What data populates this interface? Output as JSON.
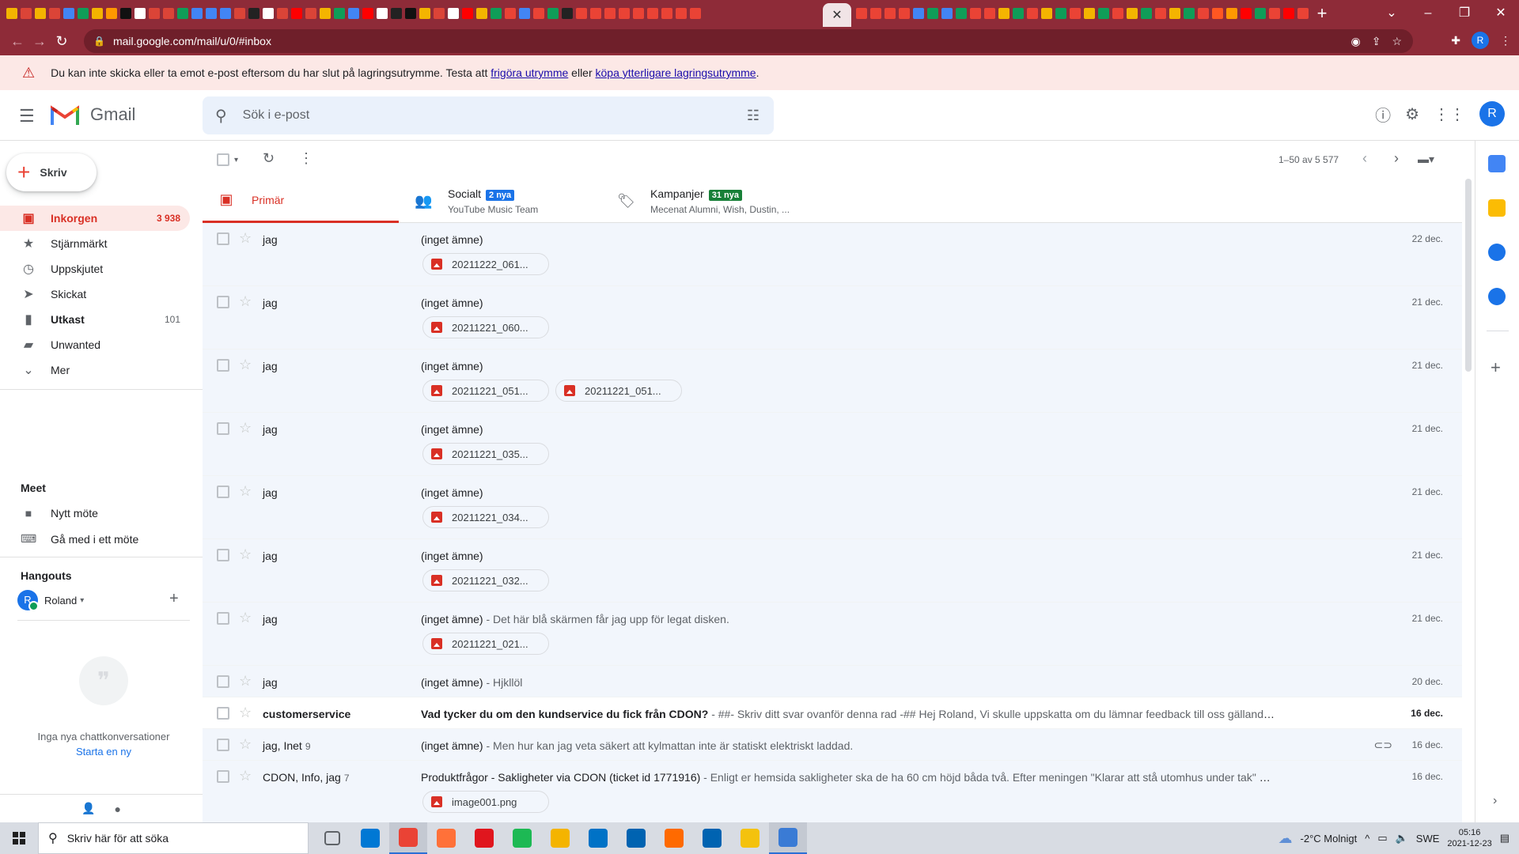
{
  "browser": {
    "url": "mail.google.com/mail/u/0/#inbox",
    "profile_initial": "R",
    "favicon_colors": [
      "#f4b400",
      "#db4437",
      "#f4b400",
      "#db4437",
      "#4285f4",
      "#0f9d58",
      "#f4b400",
      "#ff9800",
      "#111111",
      "#ffffff",
      "#db4437",
      "#db4437",
      "#0f9d58",
      "#4285f4",
      "#4285f4",
      "#4285f4",
      "#db4437",
      "#222222",
      "#ffffff",
      "#db4437",
      "#ff0000",
      "#db4437",
      "#f4b400",
      "#0f9d58",
      "#4285f4",
      "#ff0000",
      "#ffffff",
      "#222222",
      "#111111",
      "#f4b400",
      "#db4437",
      "#ffffff",
      "#ff0000",
      "#f4b400",
      "#0f9d58",
      "#ea4335",
      "#4285f4",
      "#ea4335",
      "#0f9d58",
      "#222222",
      "#ea4335",
      "#ea4335",
      "#ea4335",
      "#ea4335",
      "#ea4335",
      "#ea4335",
      "#ea4335",
      "#ea4335",
      "#ea4335"
    ],
    "favicon_colors_2": [
      "#ea4335",
      "#ea4335",
      "#ea4335",
      "#ea4335",
      "#4285f4",
      "#0f9d58",
      "#4285f4",
      "#0f9d58",
      "#ea4335",
      "#ea4335",
      "#f4b400",
      "#0f9d58",
      "#ea4335",
      "#f4b400",
      "#0f9d58",
      "#ea4335",
      "#f4b400",
      "#0f9d58",
      "#ea4335",
      "#f4b400",
      "#0f9d58",
      "#ea4335",
      "#f4b400",
      "#0f9d58",
      "#ea4335",
      "#ff5722",
      "#ff9800",
      "#ff0000",
      "#0f9d58",
      "#ea4335",
      "#ff0000",
      "#ea4335",
      "#ea4335"
    ],
    "tab_close": "✕",
    "new_tab": "+"
  },
  "banner": {
    "text_before": "Du kan inte skicka eller ta emot e-post eftersom du har slut på lagringsutrymme. Testa att ",
    "link1": "frigöra utrymme",
    "text_middle": " eller ",
    "link2": "köpa ytterligare lagringsutrymme",
    "text_after": "."
  },
  "header": {
    "app_name": "Gmail",
    "search_placeholder": "Sök i e-post",
    "avatar_initial": "R"
  },
  "compose": {
    "label": "Skriv"
  },
  "nav": [
    {
      "label": "Inkorgen",
      "count": "3 938",
      "icon": "inbox-icon"
    },
    {
      "label": "Stjärnmärkt",
      "count": "",
      "icon": "star-icon"
    },
    {
      "label": "Uppskjutet",
      "count": "",
      "icon": "clock-icon"
    },
    {
      "label": "Skickat",
      "count": "",
      "icon": "send-icon"
    },
    {
      "label": "Utkast",
      "count": "101",
      "icon": "draft-icon"
    },
    {
      "label": "Unwanted",
      "count": "",
      "icon": "label-icon"
    },
    {
      "label": "Mer",
      "count": "",
      "icon": "chevron-down-icon"
    }
  ],
  "meet": {
    "title": "Meet",
    "new_meeting": "Nytt möte",
    "join_meeting": "Gå med i ett möte"
  },
  "hangouts": {
    "title": "Hangouts",
    "user": "Roland",
    "user_initial": "R",
    "empty_text": "Inga nya chattkonversationer",
    "start_link": "Starta en ny"
  },
  "list": {
    "range": "1–50 av 5 577"
  },
  "tabs": [
    {
      "name": "Primär",
      "badge": "",
      "sub": ""
    },
    {
      "name": "Socialt",
      "badge": "2 nya",
      "sub": "YouTube Music Team"
    },
    {
      "name": "Kampanjer",
      "badge": "31 nya",
      "sub": "Mecenat Alumni, Wish, Dustin, ..."
    }
  ],
  "emails": [
    {
      "sender": "jag",
      "count": "",
      "subject": "(inget ämne)",
      "snippet": "",
      "date": "22 dec.",
      "attachments": [
        "20211222_061..."
      ],
      "unread": false,
      "clip": false
    },
    {
      "sender": "jag",
      "count": "",
      "subject": "(inget ämne)",
      "snippet": "",
      "date": "21 dec.",
      "attachments": [
        "20211221_060..."
      ],
      "unread": false,
      "clip": false
    },
    {
      "sender": "jag",
      "count": "",
      "subject": "(inget ämne)",
      "snippet": "",
      "date": "21 dec.",
      "attachments": [
        "20211221_051...",
        "20211221_051..."
      ],
      "unread": false,
      "clip": false
    },
    {
      "sender": "jag",
      "count": "",
      "subject": "(inget ämne)",
      "snippet": "",
      "date": "21 dec.",
      "attachments": [
        "20211221_035..."
      ],
      "unread": false,
      "clip": false
    },
    {
      "sender": "jag",
      "count": "",
      "subject": "(inget ämne)",
      "snippet": "",
      "date": "21 dec.",
      "attachments": [
        "20211221_034..."
      ],
      "unread": false,
      "clip": false
    },
    {
      "sender": "jag",
      "count": "",
      "subject": "(inget ämne)",
      "snippet": "",
      "date": "21 dec.",
      "attachments": [
        "20211221_032..."
      ],
      "unread": false,
      "clip": false
    },
    {
      "sender": "jag",
      "count": "",
      "subject": "(inget ämne)",
      "snippet": " - Det här blå skärmen får jag upp för legat disken.",
      "date": "21 dec.",
      "attachments": [
        "20211221_021..."
      ],
      "unread": false,
      "clip": false
    },
    {
      "sender": "jag",
      "count": "",
      "subject": "(inget ämne)",
      "snippet": " - Hjkllöl",
      "date": "20 dec.",
      "attachments": [],
      "unread": false,
      "clip": false
    },
    {
      "sender": "customerservice",
      "count": "",
      "subject": "Vad tycker du om den kundservice du fick från CDON?",
      "snippet": " - ##- Skriv ditt svar ovanför denna rad -## Hej Roland, Vi skulle uppskatta om du lämnar feedback till oss gällande den hjälp du fick ...",
      "date": "16 dec.",
      "attachments": [],
      "unread": true,
      "clip": false
    },
    {
      "sender": "jag, Inet",
      "count": "9",
      "subject": "(inget ämne)",
      "snippet": " - Men hur kan jag veta säkert att kylmattan inte är statiskt elektriskt laddad.",
      "date": "16 dec.",
      "attachments": [],
      "unread": false,
      "clip": true
    },
    {
      "sender": "CDON, Info, jag",
      "count": "7",
      "subject": "Produktfrågor - Sakligheter via CDON (ticket id 1771916)",
      "snippet": " - Enligt er hemsida sakligheter ska de ha 60 cm höjd båda två. Efter meningen \"Klarar att stå utomhus under tak\" och sedan \"Höjd ...",
      "date": "16 dec.",
      "attachments": [
        "image001.png"
      ],
      "unread": false,
      "clip": false
    }
  ],
  "taskbar": {
    "search_placeholder": "Skriv här för att söka",
    "app_colors": [
      "#5f6368",
      "#0078d4",
      "#ea4335",
      "#ff7139",
      "#e0161e",
      "#1db954",
      "#f4b400",
      "#0072c6",
      "#0063b1",
      "#ff6a00",
      "#0063b1",
      "#f4c20d",
      "#3a7bd5"
    ],
    "weather": "-2°C  Molnigt",
    "lang": "SWE",
    "time": "05:16",
    "date": "2021-12-23"
  }
}
